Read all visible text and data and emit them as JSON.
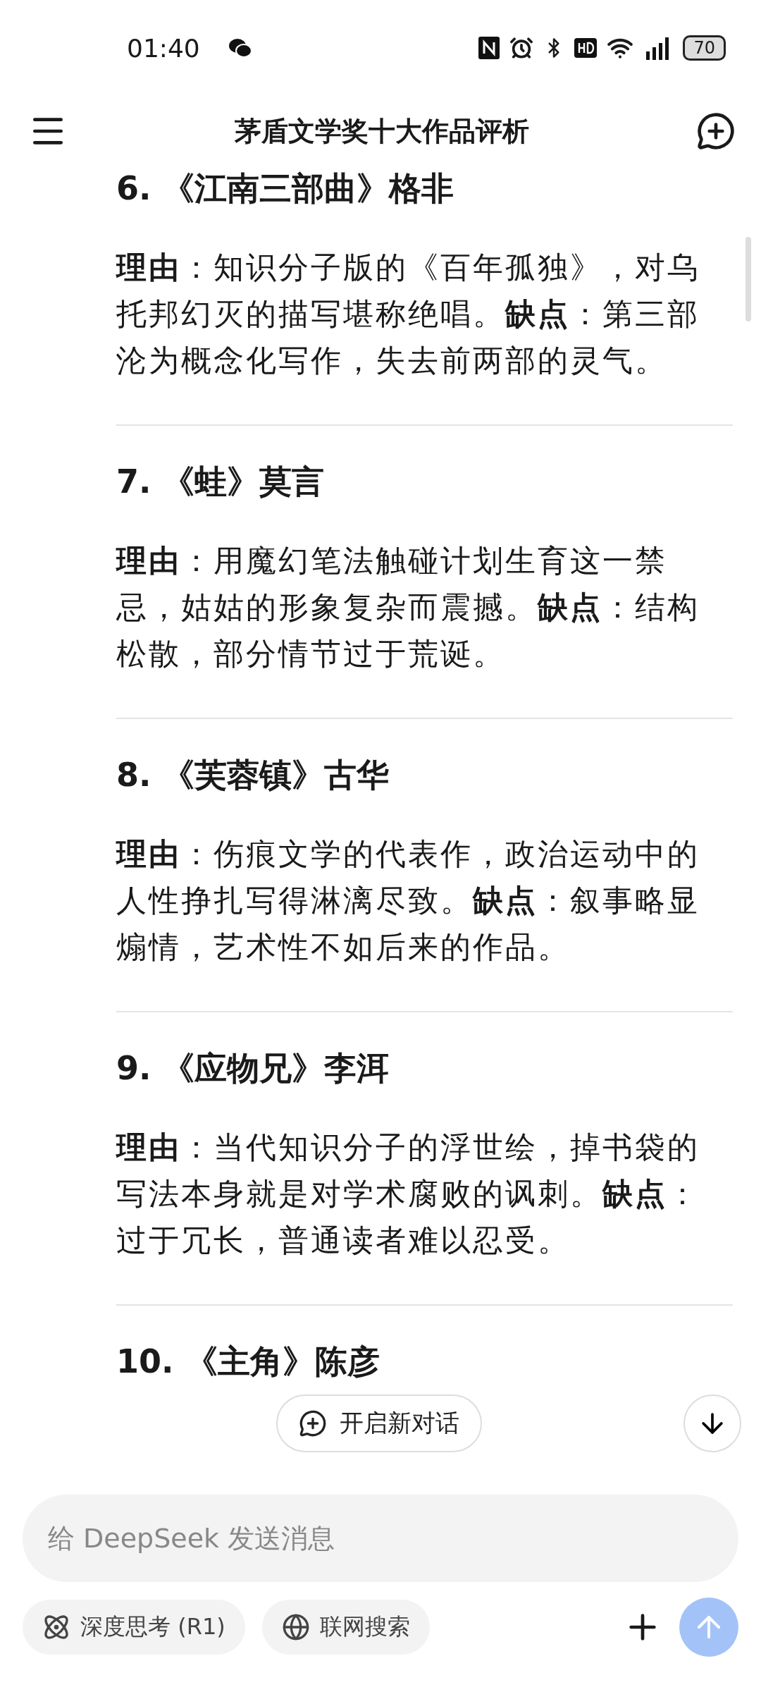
{
  "status_bar": {
    "time": "01:40",
    "battery": "70"
  },
  "header": {
    "title": "茅盾文学奖十大作品评析"
  },
  "sections": [
    {
      "heading": "6. 《江南三部曲》格非",
      "body": "**理由**：知识分子版的《百年孤独》，对乌托邦幻灭的描写堪称绝唱。**缺点**：第三部沦为概念化写作，失去前两部的灵气。"
    },
    {
      "heading": "7. 《蛙》莫言",
      "body": "**理由**：用魔幻笔法触碰计划生育这一禁忌，姑姑的形象复杂而震撼。**缺点**：结构松散，部分情节过于荒诞。"
    },
    {
      "heading": "8. 《芙蓉镇》古华",
      "body": "**理由**：伤痕文学的代表作，政治运动中的人性挣扎写得淋漓尽致。**缺点**：叙事略显煽情，艺术性不如后来的作品。"
    },
    {
      "heading": "9. 《应物兄》李洱",
      "body": "**理由**：当代知识分子的浮世绘，掉书袋的写法本身就是对学术腐败的讽刺。**缺点**：过于冗长，普通读者难以忍受。"
    },
    {
      "heading": "10. 《主角》陈彦"
    }
  ],
  "new_chat_button": "开启新对话",
  "composer": {
    "placeholder": "给 DeepSeek 发送消息",
    "toggles": [
      {
        "label": "深度思考 (R1)",
        "kind": "think",
        "selected": false
      },
      {
        "label": "联网搜索",
        "kind": "web",
        "selected": false
      }
    ],
    "send_disabled": true
  }
}
